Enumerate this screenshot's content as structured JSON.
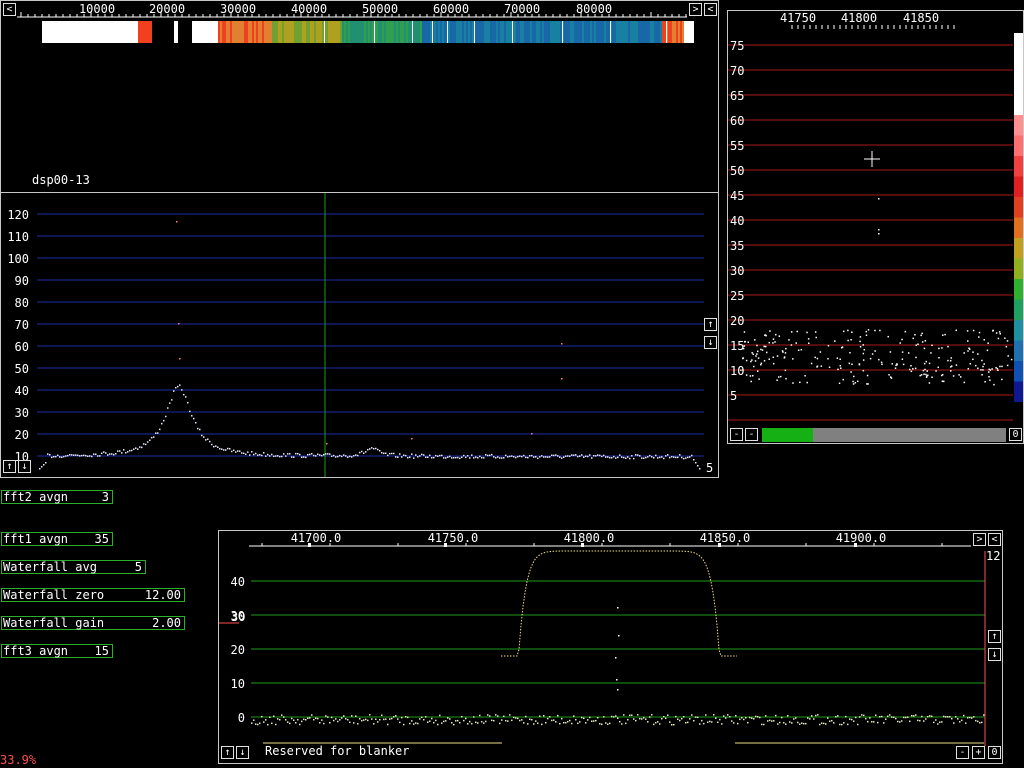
{
  "waterfall": {
    "label": "dsp00-13",
    "freq_ticks": [
      "10000",
      "20000",
      "30000",
      "40000",
      "50000",
      "60000",
      "70000",
      "80000"
    ],
    "left_btn": "<",
    "right_btn": ">",
    "back_btn": "<"
  },
  "main_spectrum": {
    "y_ticks": [
      "120",
      "110",
      "100",
      "90",
      "80",
      "70",
      "60",
      "50",
      "40",
      "30",
      "20",
      "10"
    ],
    "up_btn": "↑",
    "down_btn": "↓",
    "bottom_left_up": "↑",
    "bottom_left_down": "↓",
    "corner_value": "5"
  },
  "side_panel": {
    "freq_ticks": [
      "41750",
      "41800",
      "41850"
    ],
    "y_ticks": [
      "75",
      "70",
      "65",
      "60",
      "55",
      "50",
      "45",
      "40",
      "35",
      "30",
      "25",
      "20",
      "15",
      "10",
      "5"
    ],
    "minus1": "-",
    "minus2": "-",
    "zero_btn": "0",
    "slider_fraction": 0.21
  },
  "controls": [
    {
      "label": "fft2 avgn",
      "value": "3"
    },
    {
      "label": "fft1 avgn",
      "value": "35"
    },
    {
      "label": "Waterfall avg",
      "value": "5"
    },
    {
      "label": "Waterfall zero",
      "value": "12.00"
    },
    {
      "label": "Waterfall gain",
      "value": "2.00"
    },
    {
      "label": "fft3 avgn",
      "value": "15"
    }
  ],
  "baseband": {
    "freq_ticks": [
      "41700.0",
      "41750.0",
      "41800.0",
      "41850.0",
      "41900.0"
    ],
    "y_ticks": [
      "40",
      "30",
      "20",
      "10",
      "0"
    ],
    "right_value": "12",
    "left_marker": "30",
    "blanker_text": "Reserved for blanker",
    "right_btn": ">",
    "back_btn": "<",
    "up_btn": "↑",
    "down_btn": "↓",
    "bl_up": "↑",
    "bl_down": "↓",
    "minus_btn": "-",
    "plus_btn": "+",
    "zero_btn": "0"
  },
  "cpu_load": "33.9%",
  "colors": {
    "grid_blue": "#1c2ea8",
    "grid_red": "#a81818",
    "grid_green": "#1c9a1c",
    "accent_red": "#ff5050"
  }
}
